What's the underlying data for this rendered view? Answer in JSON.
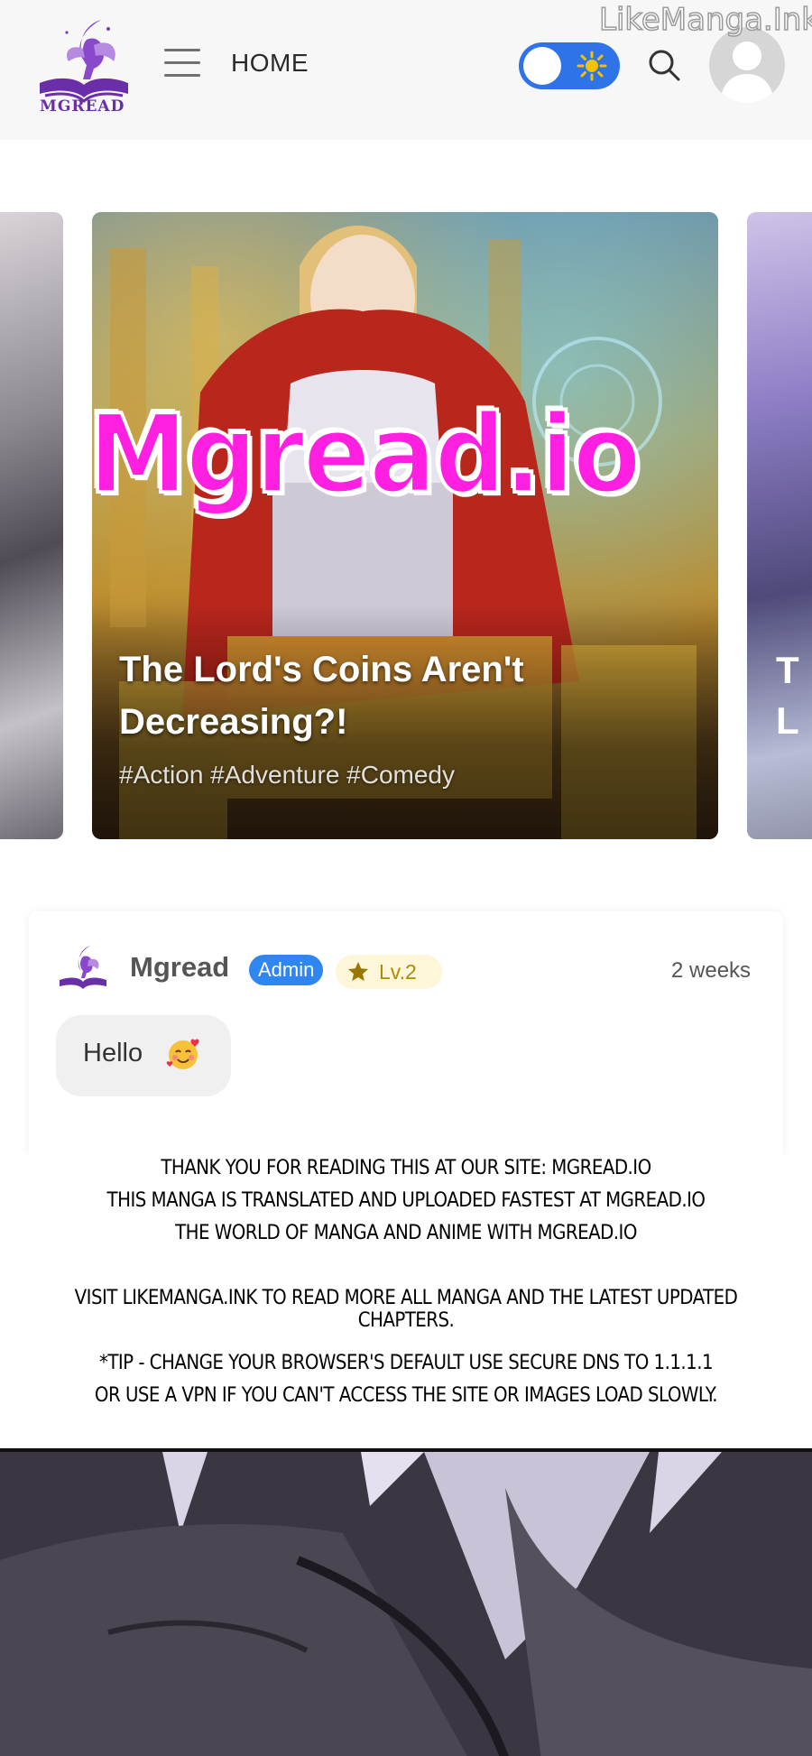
{
  "header": {
    "logo_text": "MGREAD",
    "home_label": "HOME",
    "theme_toggle_state": "light",
    "watermark": "LikeManga.Ink",
    "accent_color": "#2e73e8"
  },
  "carousel": {
    "featured": {
      "title": "The Lord's Coins Aren't Decreasing?!",
      "tags": "#Action #Adventure #Comedy"
    },
    "brand_overlay": "Mgread.io",
    "next_peek_letter_1": "T",
    "next_peek_letter_2": "L"
  },
  "comment": {
    "author": "Mgread",
    "role_badge": "Admin",
    "level_badge": "Lv.2",
    "time": "2 weeks",
    "text": "Hello",
    "emoji": "smiling-face-with-hearts-icon"
  },
  "notice": {
    "lines": [
      "THANK YOU FOR READING THIS AT OUR SITE: MGREAD.IO",
      "THIS MANGA IS TRANSLATED AND UPLOADED FASTEST AT MGREAD.IO",
      "THE WORLD OF MANGA AND ANIME WITH MGREAD.IO",
      "VISIT LIKEMANGA.INK TO READ MORE ALL MANGA AND THE LATEST UPDATED CHAPTERS.",
      "*TIP - CHANGE YOUR BROWSER'S DEFAULT USE SECURE DNS TO 1.1.1.1",
      "OR USE A VPN IF YOU CAN'T ACCESS THE SITE OR IMAGES LOAD SLOWLY."
    ]
  }
}
